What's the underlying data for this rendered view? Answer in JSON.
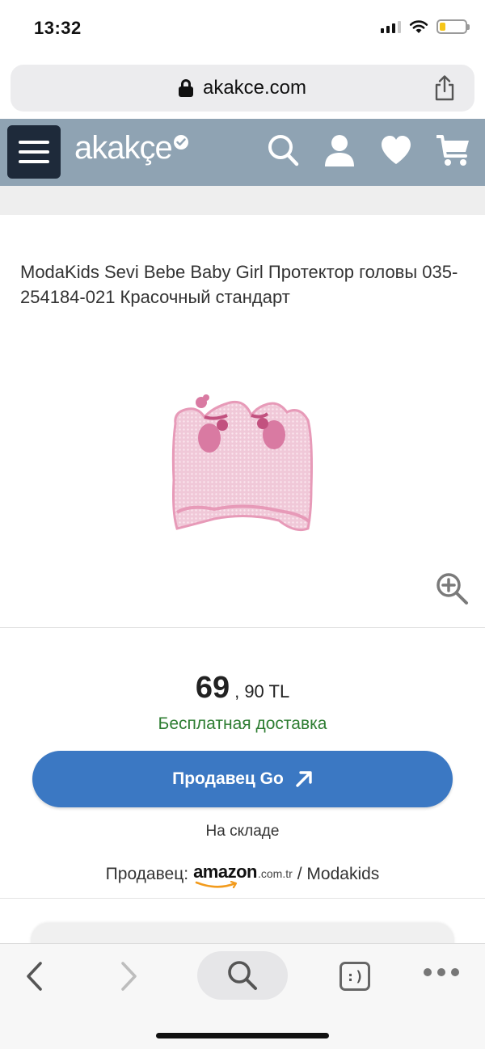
{
  "status_bar": {
    "time": "13:32",
    "signal_bars_filled": 3,
    "signal_bars_total": 4,
    "battery_level": 0.22,
    "battery_color": "#f5c518"
  },
  "browser": {
    "url": "akakce.com",
    "lock_icon": "lock-icon",
    "share_icon": "share-icon"
  },
  "header": {
    "logo_text": "akakçe",
    "background_color": "#8fa3b3",
    "menu_icon": "hamburger-icon",
    "icons": [
      "search-icon",
      "user-icon",
      "heart-icon",
      "cart-icon"
    ]
  },
  "product": {
    "title": "ModaKids Sevi Bebe Baby Girl Протектор головы 035-254184-021 Красочный стандарт",
    "image_alt": "pink baby head protector",
    "zoom_icon": "zoom-in-icon"
  },
  "offer": {
    "price_main": "69",
    "price_fraction": ", 90 TL",
    "shipping": "Бесплатная доставка",
    "shipping_color": "#2e7d32",
    "button_label": "Продавец Go",
    "button_color": "#3b78c3",
    "stock": "На складе",
    "seller_label": "Продавец:",
    "seller_logo_word": "amazon",
    "seller_logo_tld": ".com.tr",
    "seller_name": "/ Modakids"
  },
  "toolbar": {
    "back_icon": "chevron-left-icon",
    "forward_icon": "chevron-right-icon",
    "search_icon": "search-icon",
    "reader_label": ":)",
    "more_icon": "more-icon"
  }
}
